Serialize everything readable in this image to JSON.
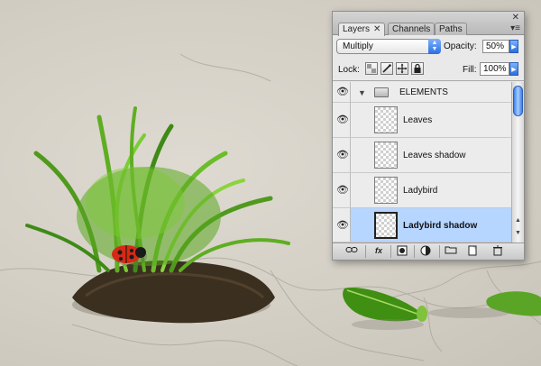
{
  "panel": {
    "tabs": [
      {
        "label": "Layers",
        "close": "✕"
      },
      {
        "label": "Channels"
      },
      {
        "label": "Paths"
      }
    ],
    "window_close": "✕",
    "menu": "▾≡"
  },
  "blend": {
    "mode": "Multiply"
  },
  "opacity": {
    "label": "Opacity:",
    "value": "50%"
  },
  "lock": {
    "label": "Lock:"
  },
  "fill": {
    "label": "Fill:",
    "value": "100%"
  },
  "layers": [
    {
      "name": "ELEMENTS",
      "type": "group",
      "visible": true
    },
    {
      "name": "Leaves",
      "type": "layer",
      "visible": true
    },
    {
      "name": "Leaves shadow",
      "type": "layer",
      "visible": true
    },
    {
      "name": "Ladybird",
      "type": "layer",
      "visible": true
    },
    {
      "name": "Ladybird shadow",
      "type": "layer",
      "visible": true,
      "selected": true
    }
  ],
  "icons": {
    "eye": "eye-icon",
    "lock_transparent": "lock-transparent-icon",
    "lock_image": "lock-image-icon",
    "lock_position": "lock-position-icon",
    "lock_all": "lock-all-icon"
  },
  "bottom_buttons": [
    "link",
    "fx",
    "mask",
    "adjustment",
    "group",
    "new-layer",
    "delete"
  ],
  "colors": {
    "selection": "#b6d5ff",
    "accent": "#2a6fe0"
  }
}
